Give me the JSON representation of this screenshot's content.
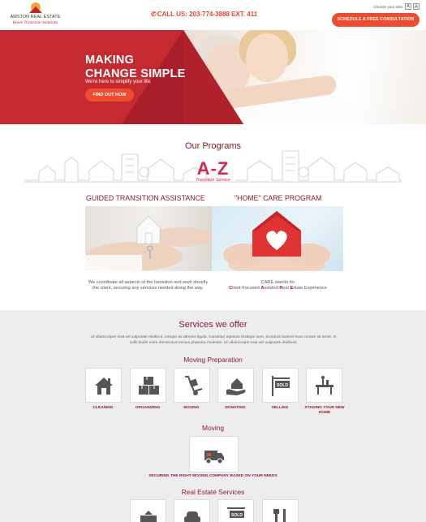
{
  "header": {
    "logo_name": "AMSTON REAL ESTATE",
    "logo_tagline": "Home Transition Solutions",
    "phone_label": "CALL US: 203-774-3888  EXT. 411",
    "font_size_label": "Choose your size:",
    "font_small": "A",
    "font_large": "A",
    "cta_label": "SCHEDULE A FREE CONSULTATION"
  },
  "hero": {
    "title_line1": "MAKING",
    "title_line2": "CHANGE SIMPLE",
    "subtitle": "We're here to simplify your life.",
    "button_label": "FIND OUT HOW"
  },
  "programs": {
    "title": "Our Programs",
    "az_label": "A-Z",
    "az_sub": "Transition Service",
    "left": {
      "heading": "GUIDED TRANSITION ASSISTANCE",
      "text": "We coordinate all aspects of the transition and work directly the client, securing any services needed along the way."
    },
    "right": {
      "heading": "\"HOME\" CARE PROGRAM",
      "text_line1": "CARE stands for",
      "care_words": [
        {
          "initial": "C",
          "rest": "lient-Focused "
        },
        {
          "initial": "A",
          "rest": "ssisted "
        },
        {
          "initial": "R",
          "rest": "eal "
        },
        {
          "initial": "E",
          "rest": "state Experience"
        }
      ]
    }
  },
  "services": {
    "title": "Services we offer",
    "description": "Ut ullamcorper erat vel vulputate eleifend. Integer at ultricies ligula. Curabitur egestas tristique sem, tincidunt laoreet risus ornare sit amet. In sollicitudin enim elementum lectus pharetra molestie. Ut ullamcorper erat vel vulputate eleifend.",
    "moving_prep": {
      "heading": "Moving Preparation",
      "items": [
        {
          "label": "CLEANING",
          "icon": "house-clean-icon"
        },
        {
          "label": "ORGANIZING",
          "icon": "boxes-icon"
        },
        {
          "label": "BOXING",
          "icon": "hand-truck-icon"
        },
        {
          "label": "DONATING",
          "icon": "hand-house-icon"
        },
        {
          "label": "SELLING",
          "icon": "sold-sign-icon"
        },
        {
          "label": "STAGING YOUR NEW HOME",
          "icon": "table-icon"
        }
      ]
    },
    "moving": {
      "heading": "Moving",
      "items": [
        {
          "label": "SECURING THE RIGHT MOVING COMPANY BASED ON YOUR NEEDS",
          "icon": "moving-truck-icon"
        }
      ]
    },
    "real_estate": {
      "heading": "Real Estate Services",
      "sold_text": "SOLD"
    },
    "sold_text": "SOLD"
  },
  "colors": {
    "brand_red": "#8c1c2b",
    "accent_orange": "#f04b2f",
    "hero_red": "#c42a30",
    "pink": "#d8254f"
  }
}
